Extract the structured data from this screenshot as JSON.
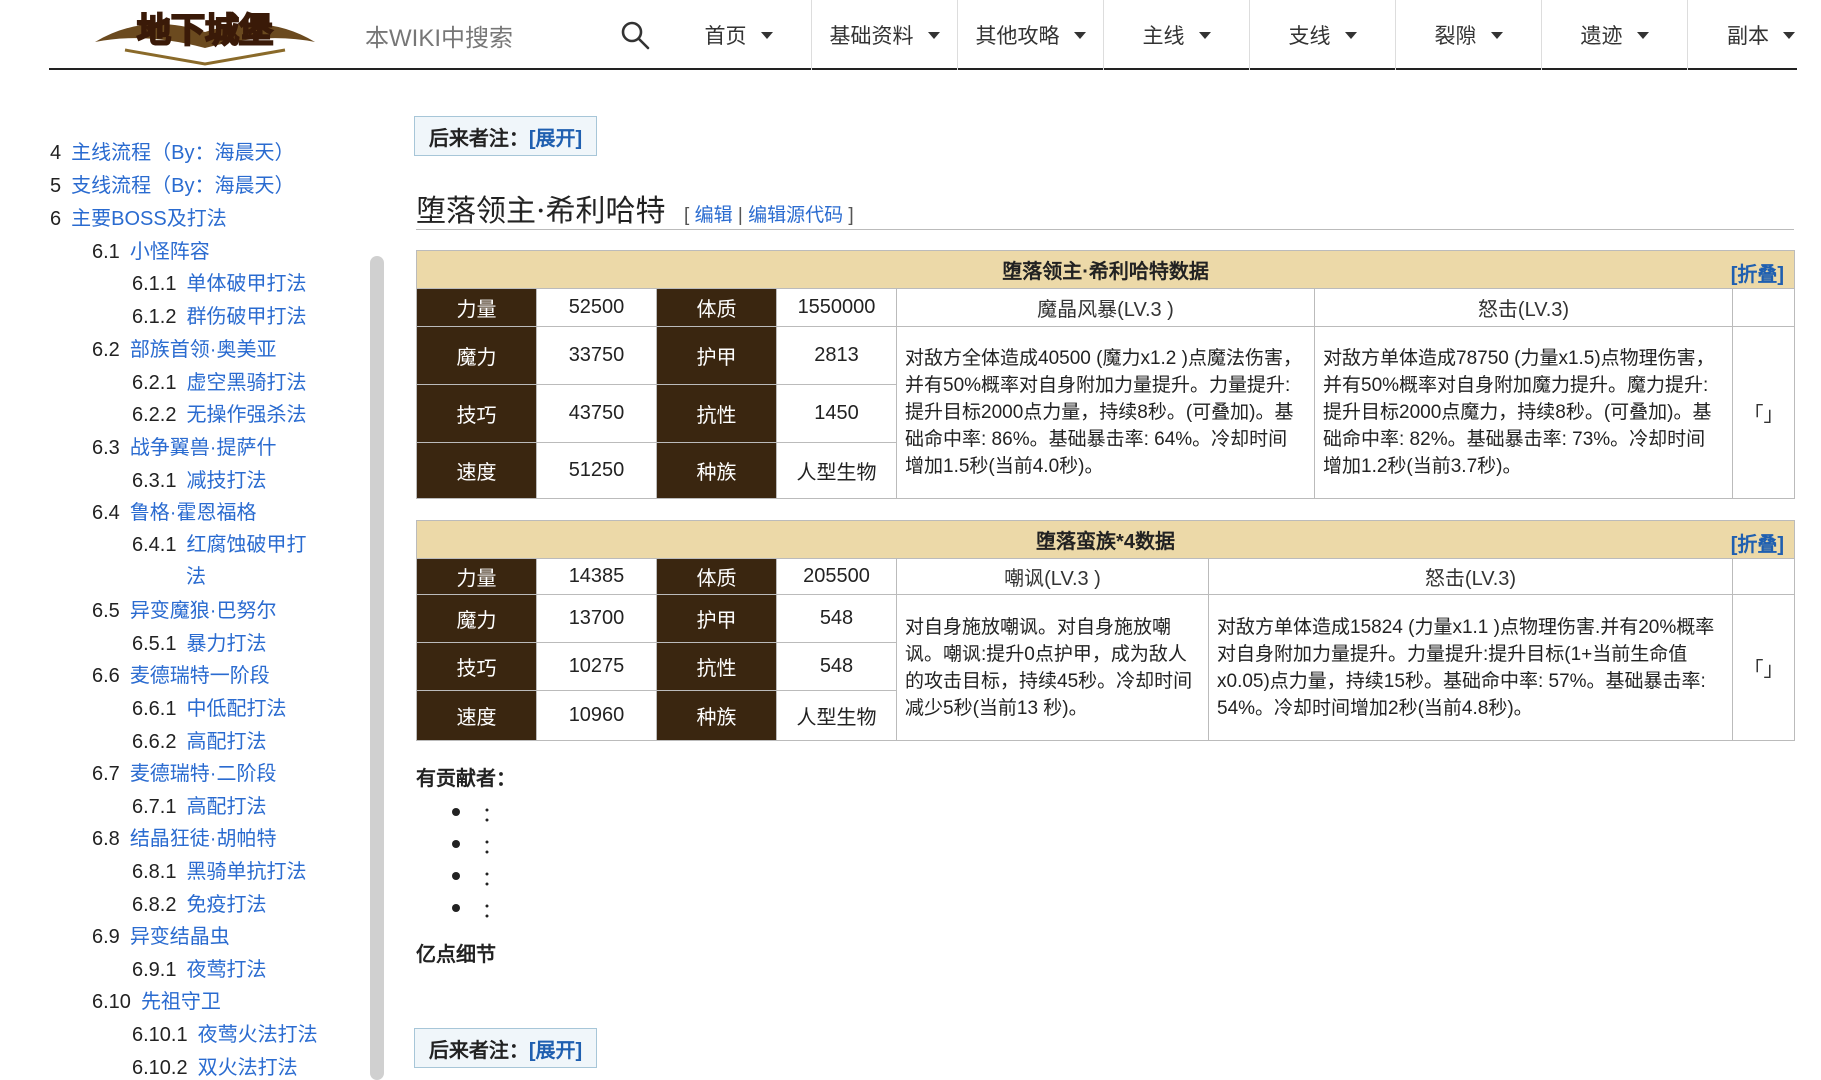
{
  "header": {
    "logo_text": "地下城堡",
    "search_placeholder": "本WIKI中搜索",
    "nav": [
      "首页",
      "基础资料",
      "其他攻略",
      "主线",
      "支线",
      "裂隙",
      "遗迹",
      "副本"
    ]
  },
  "toc": [
    {
      "num": "4",
      "label": "主线流程（By：海晨天）"
    },
    {
      "num": "5",
      "label": "支线流程（By：海晨天）"
    },
    {
      "num": "6",
      "label": "主要BOSS及打法"
    },
    {
      "num": "6.1",
      "label": "小怪阵容"
    },
    {
      "num": "6.1.1",
      "label": "单体破甲打法"
    },
    {
      "num": "6.1.2",
      "label": "群伤破甲打法"
    },
    {
      "num": "6.2",
      "label": "部族首领·奥美亚"
    },
    {
      "num": "6.2.1",
      "label": "虚空黑骑打法"
    },
    {
      "num": "6.2.2",
      "label": "无操作强杀法"
    },
    {
      "num": "6.3",
      "label": "战争翼兽·提萨什"
    },
    {
      "num": "6.3.1",
      "label": "减技打法"
    },
    {
      "num": "6.4",
      "label": "鲁格·霍恩福格"
    },
    {
      "num": "6.4.1",
      "label": "红腐蚀破甲打"
    },
    {
      "num": "",
      "label": "法"
    },
    {
      "num": "6.5",
      "label": "异变魔狼·巴努尔"
    },
    {
      "num": "6.5.1",
      "label": "暴力打法"
    },
    {
      "num": "6.6",
      "label": "麦德瑞特一阶段"
    },
    {
      "num": "6.6.1",
      "label": "中低配打法"
    },
    {
      "num": "6.6.2",
      "label": "高配打法"
    },
    {
      "num": "6.7",
      "label": "麦德瑞特·二阶段"
    },
    {
      "num": "6.7.1",
      "label": "高配打法"
    },
    {
      "num": "6.8",
      "label": "结晶狂徒·胡帕特"
    },
    {
      "num": "6.8.1",
      "label": "黑骑单抗打法"
    },
    {
      "num": "6.8.2",
      "label": "免疫打法"
    },
    {
      "num": "6.9",
      "label": "异变结晶虫"
    },
    {
      "num": "6.9.1",
      "label": "夜莺打法"
    },
    {
      "num": "6.10",
      "label": "先祖守卫"
    },
    {
      "num": "6.10.1",
      "label": "夜莺火法打法"
    },
    {
      "num": "6.10.2",
      "label": "双火法打法"
    }
  ],
  "note": {
    "label": "后来者注：",
    "expand": "[展开]"
  },
  "section": {
    "title": "堕落领主·希利哈特",
    "edit": "编辑",
    "edit_source": "编辑源代码"
  },
  "table1": {
    "title": "堕落领主·希利哈特数据",
    "fold": "[折叠]",
    "stats": [
      {
        "l1": "力量",
        "v1": "52500",
        "l2": "体质",
        "v2": "1550000"
      },
      {
        "l1": "魔力",
        "v1": "33750",
        "l2": "护甲",
        "v2": "2813"
      },
      {
        "l1": "技巧",
        "v1": "43750",
        "l2": "抗性",
        "v2": "1450"
      },
      {
        "l1": "速度",
        "v1": "51250",
        "l2": "种族",
        "v2": "人型生物"
      }
    ],
    "skill1_title": "魔晶风暴(LV.3 )",
    "skill1_desc": "对敌方全体造成40500 (魔力x1.2 )点魔法伤害，并有50%概率对自身附加力量提升。力量提升:提升目标2000点力量，持续8秒。(可叠加)。基础命中率: 86%。基础暴击率: 64%。冷却时间增加1.5秒(当前4.0秒)。",
    "skill2_title": "怒击(LV.3)",
    "skill2_desc": "对敌方单体造成78750 (力量x1.5)点物理伤害， 并有50%概率对自身附加魔力提升。魔力提升:提升目标2000点魔力，持续8秒。(可叠加)。基础命中率: 82%。基础暴击率: 73%。冷却时间增加1.2秒(当前3.7秒)。",
    "bracket": "「」"
  },
  "table2": {
    "title": "堕落蛮族*4数据",
    "fold": "[折叠]",
    "stats": [
      {
        "l1": "力量",
        "v1": "14385",
        "l2": "体质",
        "v2": "205500"
      },
      {
        "l1": "魔力",
        "v1": "13700",
        "l2": "护甲",
        "v2": "548"
      },
      {
        "l1": "技巧",
        "v1": "10275",
        "l2": "抗性",
        "v2": "548"
      },
      {
        "l1": "速度",
        "v1": "10960",
        "l2": "种族",
        "v2": "人型生物"
      }
    ],
    "skill1_title": "嘲讽(LV.3 )",
    "skill1_desc": "对自身施放嘲讽。对自身施放嘲讽。嘲讽:提升0点护甲，成为敌人的攻击目标，持续45秒。冷却时间减少5秒(当前13 秒)。",
    "skill2_title": "怒击(LV.3)",
    "skill2_desc": "对敌方单体造成15824 (力量x1.1 )点物理伤害.并有20%概率对自身附加力量提升。力量提升:提升目标(1+当前生命值x0.05)点力量，持续15秒。基础命中率: 57%。基础暴击率: 54%。冷却时间增加2秒(当前4.8秒)。",
    "bracket": "「」"
  },
  "contributors": {
    "label": "有贡献者：",
    "items": [
      "：",
      "：",
      "：",
      "："
    ]
  },
  "detail_heading": "亿点细节",
  "note2": {
    "label": "后来者注：",
    "expand": "[展开]"
  }
}
